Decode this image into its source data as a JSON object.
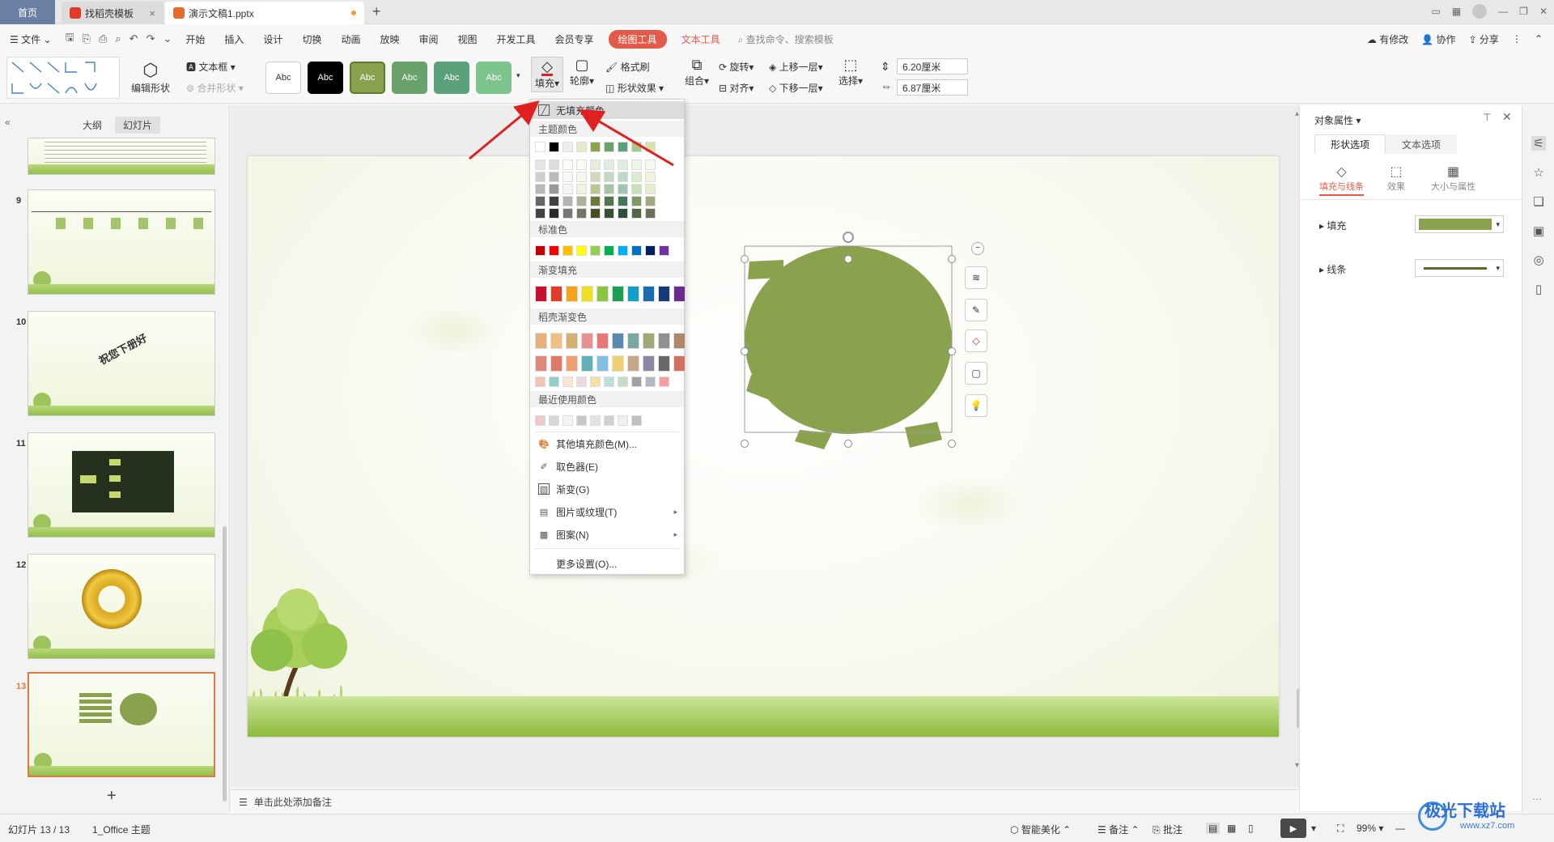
{
  "titlebar": {
    "home_tab": "首页",
    "template_tab": "找稻壳模板",
    "doc_tab": "演示文稿1.pptx"
  },
  "menu": {
    "file": "文件",
    "items": [
      "开始",
      "插入",
      "设计",
      "切换",
      "动画",
      "放映",
      "审阅",
      "视图",
      "开发工具",
      "会员专享"
    ],
    "drawing_tools": "绘图工具",
    "text_tools": "文本工具",
    "search_placeholder": "查找命令、搜索模板",
    "right": {
      "changes": "有修改",
      "collab": "协作",
      "share": "分享"
    }
  },
  "ribbon": {
    "edit_shape": "编辑形状",
    "textbox": "文本框",
    "merge_shape": "合并形状",
    "style_label": "Abc",
    "fill": "填充",
    "outline": "轮廓",
    "format_painter": "格式刷",
    "shape_effect": "形状效果",
    "group": "组合",
    "rotate": "旋转",
    "align": "对齐",
    "bring_forward": "上移一层",
    "send_backward": "下移一层",
    "select": "选择",
    "height": "6.20厘米",
    "width": "6.87厘米"
  },
  "left_panel": {
    "tab_outline": "大纲",
    "tab_slides": "幻灯片",
    "slide_numbers": [
      "9",
      "10",
      "11",
      "12",
      "13"
    ],
    "slide10_text": "祝您下册好",
    "add_button": "+"
  },
  "dropdown": {
    "no_fill": "无填充颜色",
    "theme_colors": "主题颜色",
    "standard_colors": "标准色",
    "gradient_fill": "渐变填充",
    "docer_gradient": "稻壳渐变色",
    "recent_colors": "最近使用颜色",
    "more_fill": "其他填充颜色(M)...",
    "eyedropper": "取色器(E)",
    "gradient": "渐变(G)",
    "picture_texture": "图片或纹理(T)",
    "pattern": "图案(N)",
    "more_settings": "更多设置(O)...",
    "theme_top": [
      "#ffffff",
      "#000000",
      "#eeeeee",
      "#e8eacb",
      "#8aa24e",
      "#6aa06a",
      "#5aa07a",
      "#a4cc88",
      "#d6e2a8"
    ],
    "standard": [
      "#c00000",
      "#ff0000",
      "#ffc000",
      "#ffff00",
      "#92d050",
      "#00b050",
      "#00b0f0",
      "#0070c0",
      "#002060",
      "#7030a0"
    ],
    "gradients": [
      "#c8102e",
      "#e03c2a",
      "#f2a51a",
      "#f0e020",
      "#8cc63f",
      "#1aa050",
      "#12a0c8",
      "#1a6ab0",
      "#163a7a",
      "#6a2a90"
    ],
    "docer_row1": [
      "#e8b07a",
      "#f0c080",
      "#d4b070",
      "#e89090",
      "#e87878",
      "#5a8ab0",
      "#78a8a0",
      "#a0a878",
      "#909090",
      "#b08868"
    ],
    "docer_row2": [
      "#e0887a",
      "#e07868",
      "#f0a070",
      "#60b0b8",
      "#80c0e0",
      "#f0d070",
      "#c8a888",
      "#8888a0",
      "#686868",
      "#d07060"
    ],
    "docer_row3": [
      "#f4c4b4",
      "#90d0c8",
      "#f8e8d0",
      "#ecd8e0",
      "#f8e0a0",
      "#bce0d8",
      "#c4dcc8",
      "#a0a0a0",
      "#b0b8c8",
      "#f4a0a0"
    ],
    "recent": [
      "#f0c8c8",
      "#d8d8d8",
      "#f4f4f4",
      "#c8c8c8",
      "#e4e4e4",
      "#d0d0d0",
      "#f0f0f0",
      "#c0c0c0"
    ]
  },
  "right_panel": {
    "title": "对象属性",
    "tab_shape": "形状选项",
    "tab_text": "文本选项",
    "sub_fill_line": "填充与线条",
    "sub_effect": "效果",
    "sub_size": "大小与属性",
    "fill_label": "填充",
    "line_label": "线条",
    "fill_color": "#8aa24e",
    "line_color": "#556b2f"
  },
  "notes": {
    "placeholder": "单击此处添加备注"
  },
  "status": {
    "slide_info": "幻灯片 13 / 13",
    "theme": "1_Office 主题",
    "smart": "智能美化",
    "notes": "备注",
    "comments": "批注",
    "zoom": "99%"
  },
  "watermark": {
    "brand": "极光下载站",
    "url": "www.xz7.com"
  },
  "colors": {
    "accent_red": "#e45a4a",
    "shape_green": "#8aa24e",
    "selected_slide_border": "#e4763f"
  }
}
